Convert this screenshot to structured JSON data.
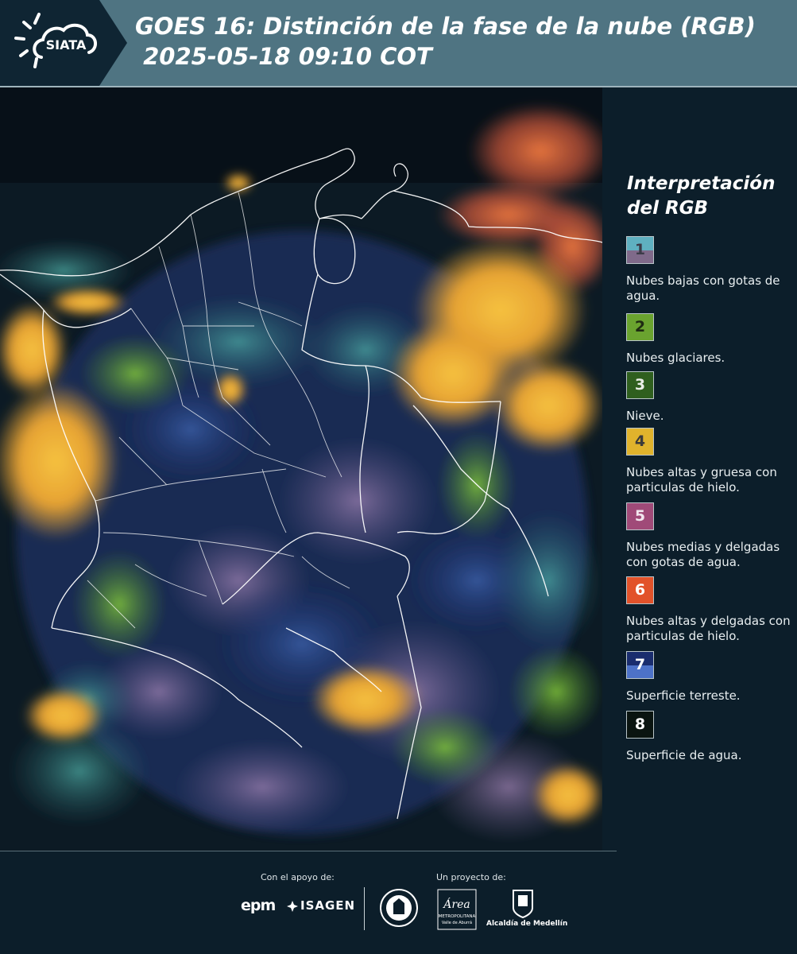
{
  "header": {
    "title": "GOES 16: Distinción de la fase de la nube (RGB)\n 2025-05-18 09:10 COT",
    "logo_text": "SIATA"
  },
  "legend": {
    "title": "Interpretación del RGB",
    "items": [
      {
        "number": "1",
        "description": "Nubes bajas con gotas de agua.",
        "color_top": "#5fb0c0",
        "color_bottom": "#7f6a8a",
        "number_color": "#3b3b48"
      },
      {
        "number": "2",
        "description": "Nubes glaciares.",
        "color": "#6aa32f",
        "number_color": "#1e2b12"
      },
      {
        "number": "3",
        "description": "Nieve.",
        "color": "#2f5f1e",
        "number_color": "#e9ede6"
      },
      {
        "number": "4",
        "description": "Nubes altas y gruesa con particulas de hielo.",
        "color": "#e0b32c",
        "number_color": "#3a3a3a"
      },
      {
        "number": "5",
        "description": "Nubes medias y delgadas con gotas de agua.",
        "color": "#a04a78",
        "number_color": "#f2e6ee"
      },
      {
        "number": "6",
        "description": "Nubes altas y delgadas con particulas de hielo.",
        "color": "#e2522a",
        "number_color": "#ffffff"
      },
      {
        "number": "7",
        "description": "Superficie terreste.",
        "color_top": "#1a2d6e",
        "color_bottom": "#4d72c8",
        "number_color": "#ffffff"
      },
      {
        "number": "8",
        "description": "Superficie de agua.",
        "color": "#0a1410",
        "number_color": "#ffffff"
      }
    ]
  },
  "footer": {
    "support_label": "Con el apoyo de:",
    "project_label": "Un proyecto de:",
    "epm": "epm",
    "isagen": "ISAGEN",
    "area_metropolitana": "Área",
    "area_sub": "METROPOLITANA",
    "area_sub2": "Valle de Aburrá",
    "alcaldia": "Alcaldía de Medellín"
  }
}
